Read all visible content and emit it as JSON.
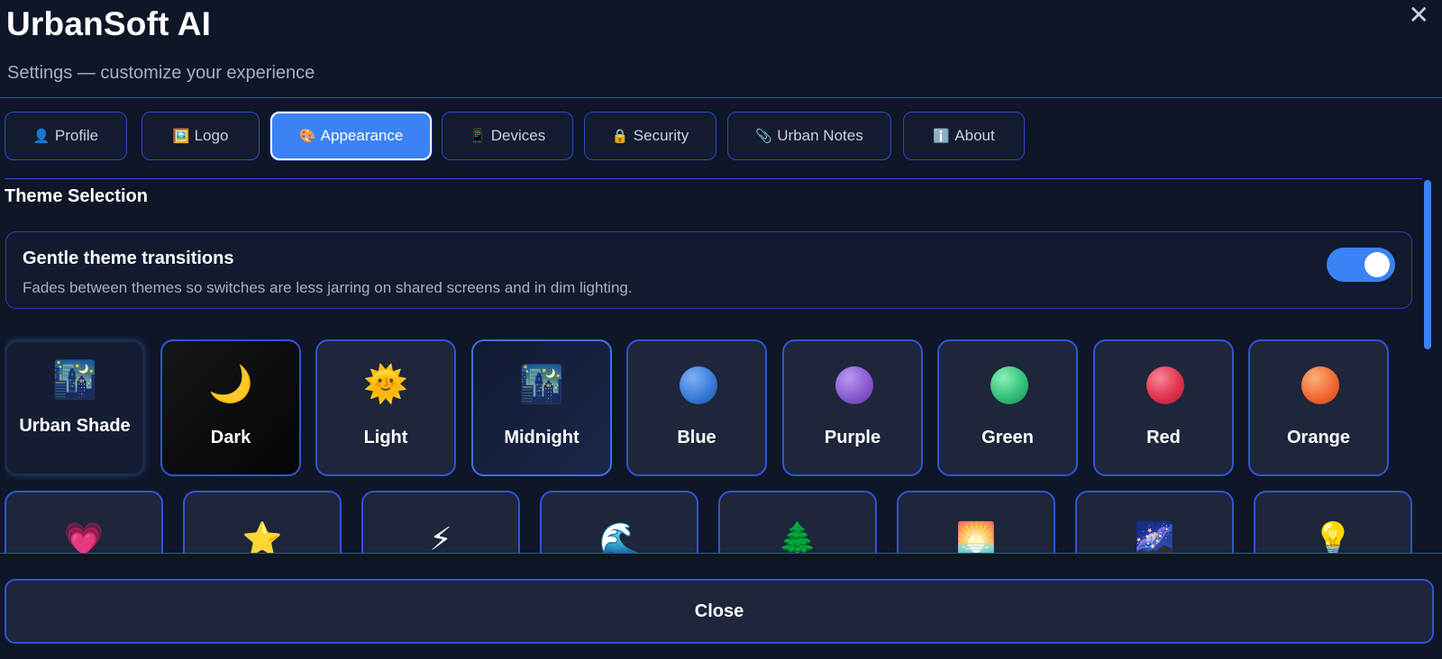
{
  "app": {
    "title": "UrbanSoft AI",
    "subtitle": "Settings — customize your experience",
    "close_glyph": "✕"
  },
  "tabs": [
    {
      "label": "Profile",
      "icon": "👤",
      "icon_name": "profile-icon",
      "active": false
    },
    {
      "label": "Logo",
      "icon": "🖼️",
      "icon_name": "image-icon",
      "active": false
    },
    {
      "label": "Appearance",
      "icon": "🎨",
      "icon_name": "palette-icon",
      "active": true
    },
    {
      "label": "Devices",
      "icon": "📱",
      "icon_name": "phone-icon",
      "active": false
    },
    {
      "label": "Security",
      "icon": "🔒",
      "icon_name": "lock-icon",
      "active": false
    },
    {
      "label": "Urban Notes",
      "icon": "📎",
      "icon_name": "paperclip-icon",
      "active": false
    },
    {
      "label": "About",
      "icon": "ℹ️",
      "icon_name": "info-icon",
      "active": false
    }
  ],
  "appearance": {
    "section_title": "Theme Selection",
    "toggle": {
      "title": "Gentle theme transitions",
      "description": "Fades between themes so switches are less jarring on shared screens and in dim lighting.",
      "enabled": true
    },
    "themes_row1": [
      {
        "label": "Urban Shade",
        "icon": "🌃",
        "icon_name": "night-city-icon"
      },
      {
        "label": "Dark",
        "icon": "🌙",
        "icon_name": "moon-icon"
      },
      {
        "label": "Light",
        "icon": "🌞",
        "icon_name": "sun-icon"
      },
      {
        "label": "Midnight",
        "icon": "🌃",
        "icon_name": "night-city-icon"
      },
      {
        "label": "Blue",
        "icon": "",
        "icon_name": "blue-orb-icon",
        "color": "#3b7ddb"
      },
      {
        "label": "Purple",
        "icon": "",
        "icon_name": "purple-orb-icon",
        "color": "#8b5bd1"
      },
      {
        "label": "Green",
        "icon": "",
        "icon_name": "green-orb-icon",
        "color": "#34c27a"
      },
      {
        "label": "Red",
        "icon": "",
        "icon_name": "red-orb-icon",
        "color": "#e0344f"
      },
      {
        "label": "Orange",
        "icon": "",
        "icon_name": "orange-orb-icon",
        "color": "#f26b35"
      }
    ],
    "themes_row2": [
      {
        "icon": "💗",
        "icon_name": "heart-icon"
      },
      {
        "icon": "⭐",
        "icon_name": "star-icon"
      },
      {
        "icon": "⚡",
        "icon_name": "lightning-icon"
      },
      {
        "icon": "🌊",
        "icon_name": "wave-icon"
      },
      {
        "icon": "🌲",
        "icon_name": "tree-icon"
      },
      {
        "icon": "🌅",
        "icon_name": "sunrise-icon"
      },
      {
        "icon": "🌌",
        "icon_name": "galaxy-icon"
      },
      {
        "icon": "💡",
        "icon_name": "lightbulb-icon"
      }
    ]
  },
  "footer": {
    "close_label": "Close"
  },
  "colors": {
    "background": "#0f1628",
    "accent": "#3b82f6",
    "border": "#2d55d8",
    "card": "#1d263a"
  }
}
